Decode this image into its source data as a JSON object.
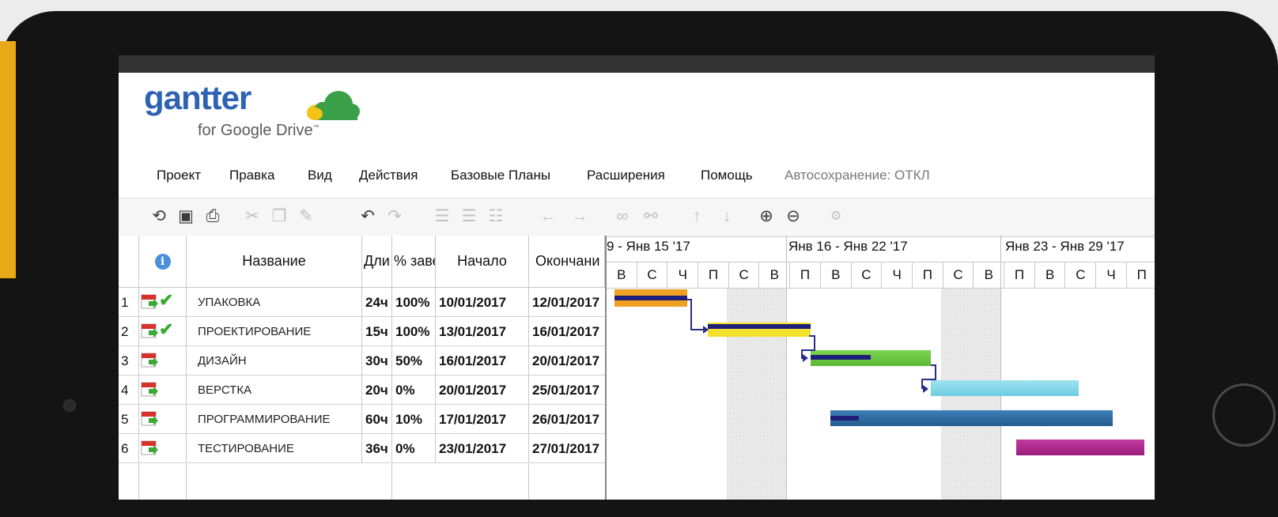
{
  "app": {
    "logo_word": "gantter",
    "logo_sub": "for Google Drive",
    "logo_tm": "™"
  },
  "menu": {
    "items": [
      "Проект",
      "Правка",
      "Вид",
      "Действия",
      "Базовые Планы",
      "Расширения",
      "Помощь"
    ],
    "autosave": "Автосохранение: ОТКЛ"
  },
  "toolbar": {
    "icons": [
      "refresh-icon",
      "save-icon",
      "print-icon",
      "cut-icon",
      "copy-icon",
      "paint-icon",
      "undo-icon",
      "redo-icon",
      "indent-icon",
      "outdent-icon",
      "insert-icon",
      "move-left-icon",
      "move-right-icon",
      "link-icon",
      "unlink-icon",
      "move-up-icon",
      "move-down-icon",
      "zoom-in-icon",
      "zoom-out-icon",
      "settings-icon"
    ]
  },
  "grid": {
    "columns": {
      "info": "i",
      "name": "Название",
      "duration": "Дли",
      "percent": "% заве",
      "start": "Начало",
      "finish": "Окончани"
    },
    "rows": [
      {
        "id": "1",
        "name": "УПАКОВКА",
        "duration": "24ч",
        "percent": "100%",
        "start": "10/01/2017",
        "finish": "12/01/2017",
        "done": true
      },
      {
        "id": "2",
        "name": "ПРОЕКТИРОВАНИЕ",
        "duration": "15ч",
        "percent": "100%",
        "start": "13/01/2017",
        "finish": "16/01/2017",
        "done": true
      },
      {
        "id": "3",
        "name": "ДИЗАЙН",
        "duration": "30ч",
        "percent": "50%",
        "start": "16/01/2017",
        "finish": "20/01/2017",
        "done": false
      },
      {
        "id": "4",
        "name": "ВЕРСТКА",
        "duration": "20ч",
        "percent": "0%",
        "start": "20/01/2017",
        "finish": "25/01/2017",
        "done": false
      },
      {
        "id": "5",
        "name": "ПРОГРАММИРОВАНИЕ",
        "duration": "60ч",
        "percent": "10%",
        "start": "17/01/2017",
        "finish": "26/01/2017",
        "done": false
      },
      {
        "id": "6",
        "name": "ТЕСТИРОВАНИЕ",
        "duration": "36ч",
        "percent": "0%",
        "start": "23/01/2017",
        "finish": "27/01/2017",
        "done": false
      }
    ]
  },
  "timeline": {
    "weeks": [
      "9 - Янв 15 '17",
      "Янв 16 - Янв 22 '17",
      "Янв 23 - Янв 29 '17"
    ],
    "days": [
      "В",
      "С",
      "Ч",
      "П",
      "С",
      "В",
      "П",
      "В",
      "С",
      "Ч",
      "П",
      "С",
      "В",
      "П",
      "В",
      "С",
      "Ч",
      "П"
    ],
    "bar_colors": [
      "#f0a020",
      "#f3e02a",
      "#6cc040",
      "#7cd6e8",
      "#2f6ea0",
      "#b0288f"
    ],
    "progress_color": "#1f1f7a"
  }
}
